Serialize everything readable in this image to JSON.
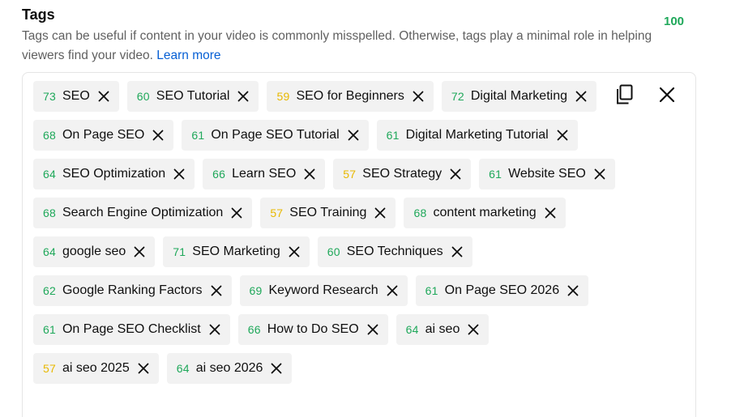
{
  "header": {
    "title": "Tags",
    "total_score": "100",
    "description": "Tags can be useful if content in your video is commonly misspelled. Otherwise, tags play a minimal role in helping viewers find your video.",
    "learn_more": "Learn more"
  },
  "colors": {
    "score_good": "#1fa85a",
    "score_ok": "#e8b800",
    "link": "#065fd4"
  },
  "icons": {
    "copy": "copy-icon",
    "clear": "close-icon",
    "remove": "close-icon"
  },
  "tags": [
    {
      "score": "73",
      "label": "SEO",
      "level": "green"
    },
    {
      "score": "60",
      "label": "SEO Tutorial",
      "level": "green"
    },
    {
      "score": "59",
      "label": "SEO for Beginners",
      "level": "yellow"
    },
    {
      "score": "72",
      "label": "Digital Marketing",
      "level": "green"
    },
    {
      "score": "68",
      "label": "On Page SEO",
      "level": "green"
    },
    {
      "score": "61",
      "label": "On Page SEO Tutorial",
      "level": "green"
    },
    {
      "score": "61",
      "label": "Digital Marketing Tutorial",
      "level": "green"
    },
    {
      "score": "64",
      "label": "SEO Optimization",
      "level": "green"
    },
    {
      "score": "66",
      "label": "Learn SEO",
      "level": "green"
    },
    {
      "score": "57",
      "label": "SEO Strategy",
      "level": "yellow"
    },
    {
      "score": "61",
      "label": "Website SEO",
      "level": "green"
    },
    {
      "score": "68",
      "label": "Search Engine Optimization",
      "level": "green"
    },
    {
      "score": "57",
      "label": "SEO Training",
      "level": "yellow"
    },
    {
      "score": "68",
      "label": "content marketing",
      "level": "green"
    },
    {
      "score": "64",
      "label": "google seo",
      "level": "green"
    },
    {
      "score": "71",
      "label": "SEO Marketing",
      "level": "green"
    },
    {
      "score": "60",
      "label": "SEO Techniques",
      "level": "green"
    },
    {
      "score": "62",
      "label": "Google Ranking Factors",
      "level": "green"
    },
    {
      "score": "69",
      "label": "Keyword Research",
      "level": "green"
    },
    {
      "score": "61",
      "label": "On Page SEO 2026",
      "level": "green"
    },
    {
      "score": "61",
      "label": "On Page SEO Checklist",
      "level": "green"
    },
    {
      "score": "66",
      "label": "How to Do SEO",
      "level": "green"
    },
    {
      "score": "64",
      "label": "ai seo",
      "level": "green"
    },
    {
      "score": "57",
      "label": "ai seo 2025",
      "level": "yellow"
    },
    {
      "score": "64",
      "label": "ai seo 2026",
      "level": "green"
    }
  ]
}
